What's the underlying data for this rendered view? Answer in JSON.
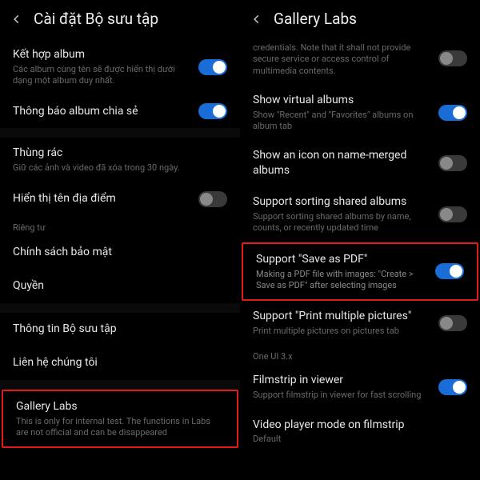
{
  "left": {
    "title": "Cài đặt Bộ sưu tập",
    "items": {
      "combine": {
        "title": "Kết hợp album",
        "sub": "Các album cùng tên sẽ được hiển thị dưới dạng một album duy nhất."
      },
      "shared_notify": {
        "title": "Thông báo album chia sẻ"
      },
      "trash": {
        "title": "Thùng rác",
        "sub": "Giữ các ảnh và video đã xóa trong 30 ngày."
      },
      "location": {
        "title": "Hiển thị tên địa điểm"
      },
      "privacy_label": "Riêng tư",
      "privacy_policy": {
        "title": "Chính sách bảo mật"
      },
      "permissions": {
        "title": "Quyền"
      },
      "about": {
        "title": "Thông tin Bộ sưu tập"
      },
      "contact": {
        "title": "Liên hệ chúng tôi"
      },
      "labs": {
        "title": "Gallery Labs",
        "sub": "This is only for internal test. The functions in Labs are not official and can be disappeared"
      }
    }
  },
  "right": {
    "title": "Gallery Labs",
    "items": {
      "creds": {
        "sub": "credentials. Note that it shall not provide secure service or access control of multimedia contents."
      },
      "virtual": {
        "title": "Show virtual albums",
        "sub": "Show \"Recent\" and \"Favorites\" albums on album tab"
      },
      "merged_icon": {
        "title": "Show an icon on name-merged albums"
      },
      "sort_shared": {
        "title": "Support sorting shared albums",
        "sub": "Support sorting shared albums by name, counts, or recently updated time"
      },
      "save_pdf": {
        "title": "Support \"Save as PDF\"",
        "sub": "Making a PDF file with images: \"Create > Save as PDF\" after selecting images"
      },
      "print_multi": {
        "title": "Support \"Print multiple pictures\"",
        "sub": "Print multiple pictures on pictures tab"
      },
      "oneui_label": "One UI 3.x",
      "filmstrip": {
        "title": "Filmstrip in viewer",
        "sub": "Support filmstrip in viewer for fast scrolling"
      },
      "video_filmstrip": {
        "title": "Video player mode on filmstrip",
        "sub": "Default"
      }
    }
  }
}
